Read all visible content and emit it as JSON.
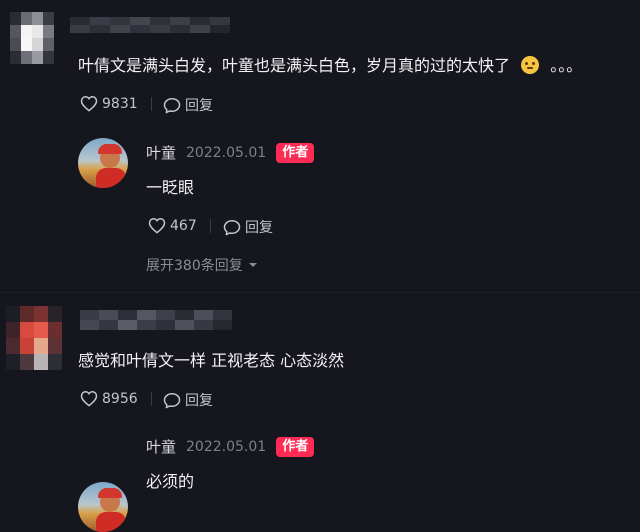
{
  "comments": [
    {
      "text": "叶倩文是满头白发，叶童也是满头白色，岁月真的过的太快了",
      "trailing": "。。。",
      "likes": "9831",
      "reply_label": "回复",
      "reply": {
        "username": "叶童",
        "date": "2022.05.01",
        "badge": "作者",
        "text": "一眨眼",
        "likes": "467",
        "reply_label": "回复",
        "expand_label": "展开380条回复"
      }
    },
    {
      "text": "感觉和叶倩文一样 正视老态 心态淡然",
      "likes": "8956",
      "reply_label": "回复",
      "reply": {
        "username": "叶童",
        "date": "2022.05.01",
        "badge": "作者",
        "text": "必须的"
      }
    }
  ],
  "colors": {
    "background": "#15161e",
    "author_badge": "#fe2c55",
    "muted_text": "#8b8c94"
  },
  "icons": [
    "heart-icon",
    "comment-bubble-icon",
    "caret-down-icon",
    "emoji-icon"
  ]
}
